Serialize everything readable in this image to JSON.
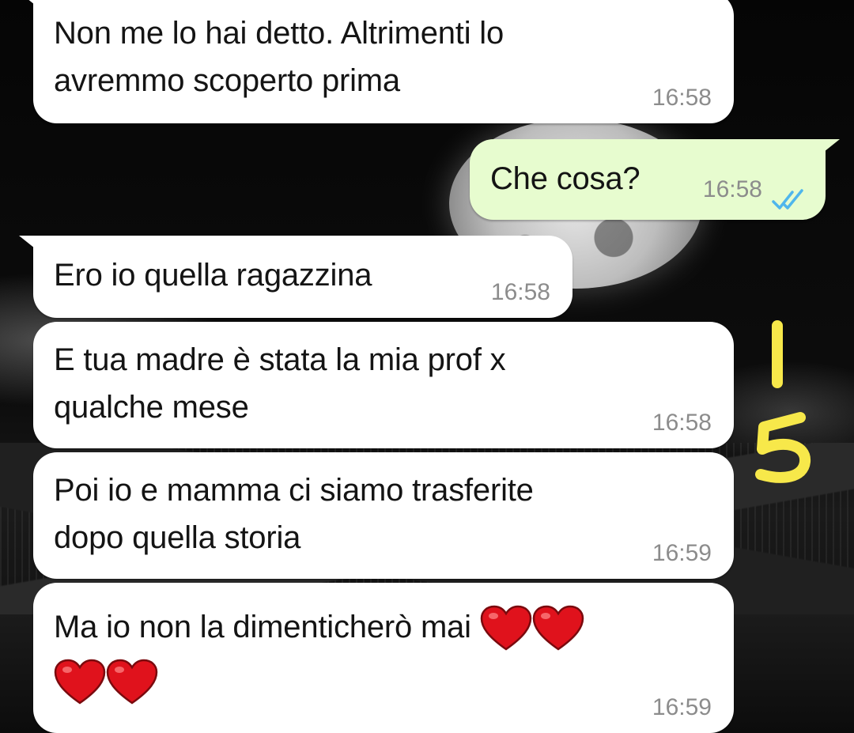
{
  "colors": {
    "incoming_bubble": "#ffffff",
    "outgoing_bubble": "#e7fccf",
    "text": "#141414",
    "timestamp": "#8c8c8c",
    "read_ticks": "#4fb6ec",
    "annotation_marker": "#f7e84a",
    "heart": "#e0121c"
  },
  "messages": [
    {
      "direction": "incoming",
      "text": "Non me lo hai detto. Altrimenti lo\navremmo scoperto prima",
      "time": "16:58"
    },
    {
      "direction": "outgoing",
      "text": "Che cosa?",
      "time": "16:58",
      "status_icon": "double-check-read-icon"
    },
    {
      "direction": "incoming",
      "text": "Ero io quella ragazzina",
      "time": "16:58"
    },
    {
      "direction": "incoming",
      "text": "E tua madre è stata la mia prof x\nqualche mese",
      "time": "16:58"
    },
    {
      "direction": "incoming",
      "text": "Poi io e mamma ci siamo trasferite\ndopo quella storia",
      "time": "16:59"
    },
    {
      "direction": "incoming",
      "text": "Ma io non la dimenticherò mai",
      "emoji": [
        "red-heart",
        "red-heart",
        "red-heart",
        "red-heart"
      ],
      "time": "16:59"
    }
  ],
  "annotation": {
    "text": "15",
    "icon": "handwritten-15-marker"
  }
}
